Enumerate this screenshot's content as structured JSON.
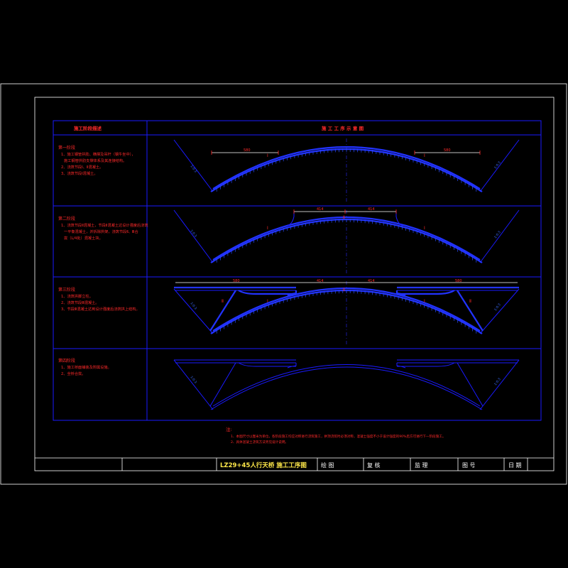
{
  "colors": {
    "background": "#000000",
    "frame": "#ffffff",
    "drawing": "#1a1aff",
    "note_text": "#ff2a2a",
    "title_text": "#ffe94a"
  },
  "table": {
    "left_header": "施工阶段描述",
    "right_header": "施 工 工 序 示 意 图"
  },
  "stages": [
    {
      "title": "第一阶段",
      "lines": [
        "1、施工钢管拱肋、横撑及吊杆（钢牛坐中），",
        "施工钢管拱肋支撑体系及其连接结构。",
        "2、浇筑节段Ⅰ、Ⅱ混凝土。",
        "3、浇筑节段Ⅰ混凝土。"
      ],
      "dims": [
        "580",
        "580"
      ],
      "angles": [
        "1:0.3",
        "1:0.3"
      ],
      "segments": [
        "Ⅰ",
        "Ⅰ"
      ]
    },
    {
      "title": "第二阶段",
      "lines": [
        "1、浇筑节段Ⅱ混凝土，节段Ⅱ混凝土达设计强度后浇筑",
        "一平衡混凝土，并拆除拱架，浇筑节段Ⅱ、Ⅲ合",
        "拢（L/4处）混凝土块。"
      ],
      "dims": [
        "414",
        "414"
      ],
      "angles": [
        "1:0.3",
        "1:0.3"
      ],
      "segments": [
        "Ⅰ",
        "Ⅱ",
        "Ⅰ"
      ]
    },
    {
      "title": "第三阶段",
      "lines": [
        "1、浇筑拱脚立柱。",
        "2、浇筑节段Ⅲ混凝土。",
        "3、节段Ⅲ混凝土达到设计强度后浇筑拱上结构。"
      ],
      "dims": [
        "580",
        "414",
        "414",
        "580"
      ],
      "angles": [
        "1:0.3",
        "1:0.3"
      ],
      "segments": [
        "Ⅱ",
        "Ⅰ",
        "Ⅱ",
        "Ⅰ",
        "Ⅱ"
      ]
    },
    {
      "title": "第四阶段",
      "lines": [
        "1、施工桥面铺装及附属设施。",
        "2、全桥合拢。"
      ],
      "dims": [],
      "angles": [
        "1:0.3",
        "1:0.3"
      ],
      "segments": []
    }
  ],
  "notes": {
    "label": "注:",
    "lines": [
      "1、本图尺寸以厘米为单位，各阶段施工均应对称进行浇筑施工，拱顶浇筑时必须对称，混凝土强度不小于设计强度的90%后方可进行下一阶段施工。",
      "2、具体混凝土浇筑方法另见设计说明。"
    ]
  },
  "title_block": {
    "drawing_title": "LZ29+45人行天桥 施工工序图",
    "labels": [
      "绘 图",
      "复 核",
      "监 理",
      "图 号",
      "日 期"
    ]
  }
}
